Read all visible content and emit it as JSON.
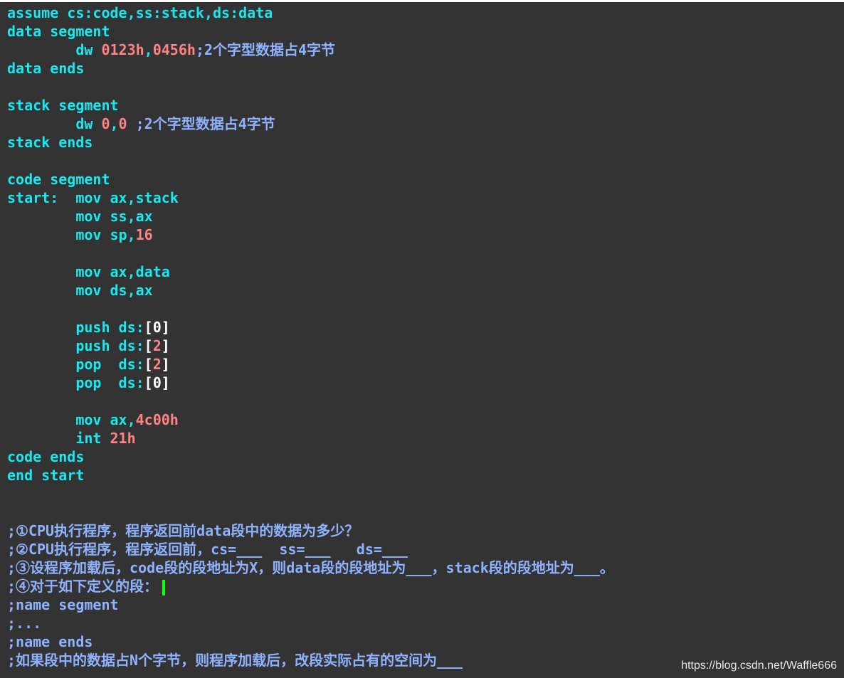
{
  "lines": [
    [
      {
        "t": "assume cs:code,ss:stack,ds:data",
        "c": "kw"
      }
    ],
    [
      {
        "t": "data segment",
        "c": "kw"
      }
    ],
    [
      {
        "t": "        dw ",
        "c": "kw"
      },
      {
        "t": "0123h",
        "c": "num"
      },
      {
        "t": ",",
        "c": "kw"
      },
      {
        "t": "0456h",
        "c": "num"
      },
      {
        "t": ";2个字型数据占4字节",
        "c": "cm"
      }
    ],
    [
      {
        "t": "data ends",
        "c": "kw"
      }
    ],
    [],
    [
      {
        "t": "stack segment",
        "c": "kw"
      }
    ],
    [
      {
        "t": "        dw ",
        "c": "kw"
      },
      {
        "t": "0",
        "c": "num"
      },
      {
        "t": ",",
        "c": "kw"
      },
      {
        "t": "0",
        "c": "num"
      },
      {
        "t": " ;2个字型数据占4字节",
        "c": "cm"
      }
    ],
    [
      {
        "t": "stack ends",
        "c": "kw"
      }
    ],
    [],
    [
      {
        "t": "code segment",
        "c": "kw"
      }
    ],
    [
      {
        "t": "start:  mov ax,stack",
        "c": "kw"
      }
    ],
    [
      {
        "t": "        mov ss,ax",
        "c": "kw"
      }
    ],
    [
      {
        "t": "        mov sp,",
        "c": "kw"
      },
      {
        "t": "16",
        "c": "num"
      }
    ],
    [],
    [
      {
        "t": "        mov ax,data",
        "c": "kw"
      }
    ],
    [
      {
        "t": "        mov ds,ax",
        "c": "kw"
      }
    ],
    [],
    [
      {
        "t": "        push ds:",
        "c": "kw"
      },
      {
        "t": "[",
        "c": "br"
      },
      {
        "t": "0",
        "c": "br"
      },
      {
        "t": "]",
        "c": "br"
      }
    ],
    [
      {
        "t": "        push ds:",
        "c": "kw"
      },
      {
        "t": "[",
        "c": "br"
      },
      {
        "t": "2",
        "c": "num"
      },
      {
        "t": "]",
        "c": "br"
      }
    ],
    [
      {
        "t": "        pop  ds:",
        "c": "kw"
      },
      {
        "t": "[",
        "c": "br"
      },
      {
        "t": "2",
        "c": "num"
      },
      {
        "t": "]",
        "c": "br"
      }
    ],
    [
      {
        "t": "        pop  ds:",
        "c": "kw"
      },
      {
        "t": "[",
        "c": "br"
      },
      {
        "t": "0",
        "c": "br"
      },
      {
        "t": "]",
        "c": "br"
      }
    ],
    [],
    [
      {
        "t": "        mov ax,",
        "c": "kw"
      },
      {
        "t": "4c00h",
        "c": "num"
      }
    ],
    [
      {
        "t": "        int ",
        "c": "kw"
      },
      {
        "t": "21h",
        "c": "num"
      }
    ],
    [
      {
        "t": "code ends",
        "c": "kw"
      }
    ],
    [
      {
        "t": "end start",
        "c": "kw"
      }
    ],
    [],
    [],
    [
      {
        "t": ";①CPU执行程序，程序返回前data段中的数据为多少？",
        "c": "cm"
      }
    ],
    [
      {
        "t": ";②CPU执行程序，程序返回前，cs=___  ss=___   ds=___",
        "c": "cm"
      }
    ],
    [
      {
        "t": ";③设程序加载后，code段的段地址为X，则data段的段地址为___，stack段的段地址为___。",
        "c": "cm"
      }
    ],
    [
      {
        "t": ";④对于如下定义的段：",
        "c": "cm",
        "cursor": true
      }
    ],
    [
      {
        "t": ";name segment",
        "c": "cm"
      }
    ],
    [
      {
        "t": ";...",
        "c": "cm"
      }
    ],
    [
      {
        "t": ";name ends",
        "c": "cm"
      }
    ],
    [
      {
        "t": ";如果段中的数据占N个字节，则程序加载后，改段实际占有的空间为___",
        "c": "cm"
      }
    ]
  ],
  "watermark": "https://blog.csdn.net/Waffle666",
  "colors": {
    "background": "#333333",
    "keyword": "#19e8ee",
    "number": "#ff8383",
    "comment": "#8fb2ff",
    "cursor": "#13ff13"
  }
}
